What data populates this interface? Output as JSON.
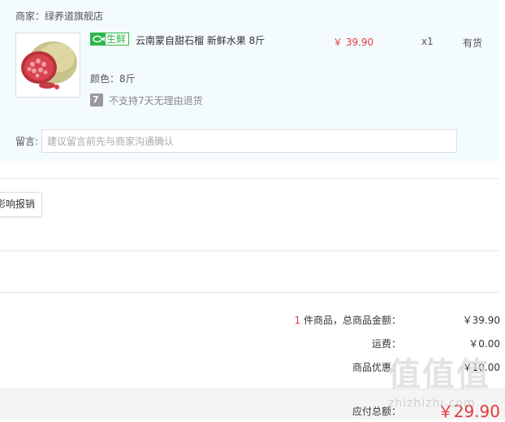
{
  "merchant": {
    "label": "商家：",
    "name": "绿养道旗舰店"
  },
  "product": {
    "tag": "生鲜",
    "name": "云南蒙自甜石榴 新鲜水果 8斤",
    "price": "￥ 39.90",
    "quantity": "x1",
    "stock": "有货",
    "spec": "颜色：8斤",
    "return_icon": "7",
    "return_policy": "不支持7天无理由退货"
  },
  "note": {
    "label": "留言:",
    "placeholder": "建议留言前先与商家沟通确认"
  },
  "reimburse_button": "影响报销",
  "summary": {
    "count": "1",
    "count_label": "件商品，总商品金额：",
    "subtotal": "￥39.90",
    "shipping_label": "运费：",
    "shipping": "￥0.00",
    "discount_label": "商品优惠：",
    "discount": "-￥10.00",
    "total_label": "应付总额：",
    "total": "￥29.90"
  },
  "watermark": {
    "glyphs": "值值值",
    "text": "zhizhizhi.com"
  },
  "colors": {
    "price_red": "#e4393c",
    "fresh_green": "#2db74a",
    "shop_bg": "#f3fbfe"
  },
  "icons": {
    "fresh": "fish-icon",
    "no_return": "no-7day-return-icon"
  }
}
